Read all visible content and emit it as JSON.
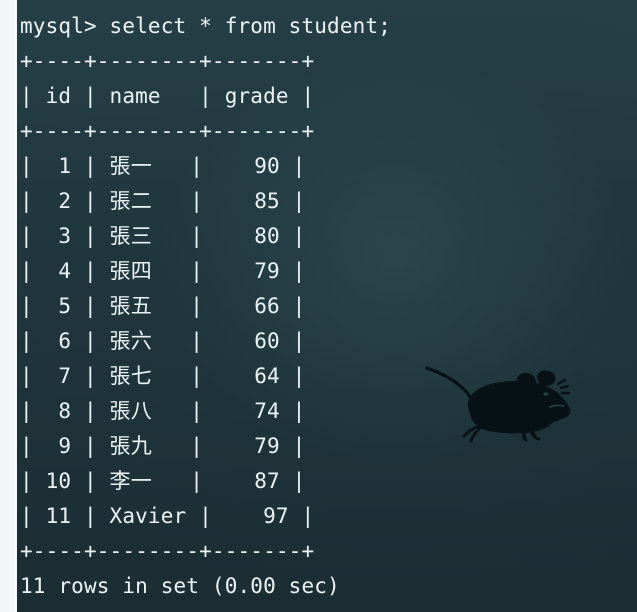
{
  "terminal": {
    "prompt": "mysql> select * from student;",
    "border_top": "+----+--------+-------+",
    "header": "| id | name   | grade |",
    "border_mid": "+----+--------+-------+",
    "rows": [
      "|  1 | 張一   |    90 |",
      "|  2 | 張二   |    85 |",
      "|  3 | 張三   |    80 |",
      "|  4 | 張四   |    79 |",
      "|  5 | 張五   |    66 |",
      "|  6 | 張六   |    60 |",
      "|  7 | 張七   |    64 |",
      "|  8 | 張八   |    74 |",
      "|  9 | 張九   |    79 |",
      "| 10 | 李一   |    87 |",
      "| 11 | Xavier |    97 |"
    ],
    "border_bottom": "+----+--------+-------+",
    "status": "11 rows in set (0.00 sec)"
  },
  "decor": {
    "icon": "mouse-icon",
    "background_color": "#20363d",
    "foreground_color": "#e9f1f3"
  }
}
